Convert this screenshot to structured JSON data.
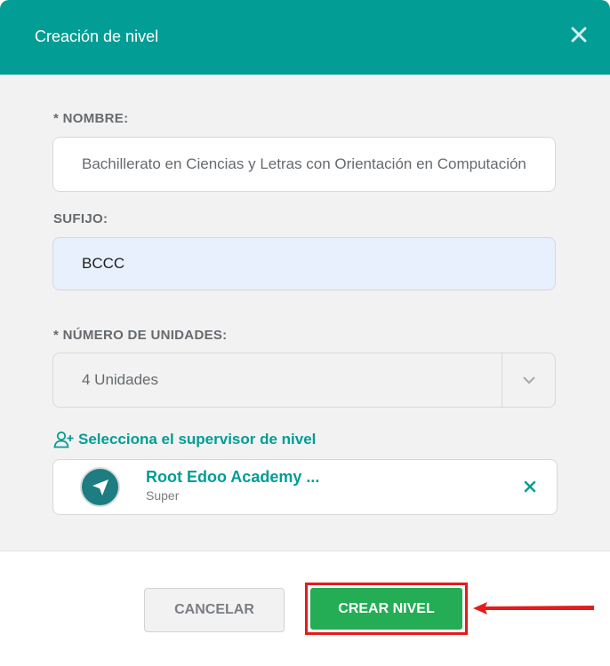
{
  "header": {
    "title": "Creación de nivel"
  },
  "form": {
    "nombre": {
      "label": "* NOMBRE:",
      "value": "Bachillerato en Ciencias y Letras con Orientación en Computación"
    },
    "sufijo": {
      "label": "SUFIJO:",
      "value": "BCCC"
    },
    "unidades": {
      "label": "* NÚMERO DE UNIDADES:",
      "value": "4 Unidades"
    }
  },
  "supervisor": {
    "link_label": "Selecciona el supervisor de nivel",
    "selected": {
      "name": "Root Edoo Academy ...",
      "role": "Super"
    }
  },
  "footer": {
    "cancel_label": "CANCELAR",
    "create_label": "CREAR NIVEL"
  },
  "colors": {
    "accent": "#029d95",
    "create": "#24ad55",
    "highlight": "#e51b1b"
  },
  "icons": [
    "close-icon",
    "chevron-down-icon",
    "add-user-icon",
    "send-icon",
    "remove-icon",
    "arrow-left-icon"
  ]
}
